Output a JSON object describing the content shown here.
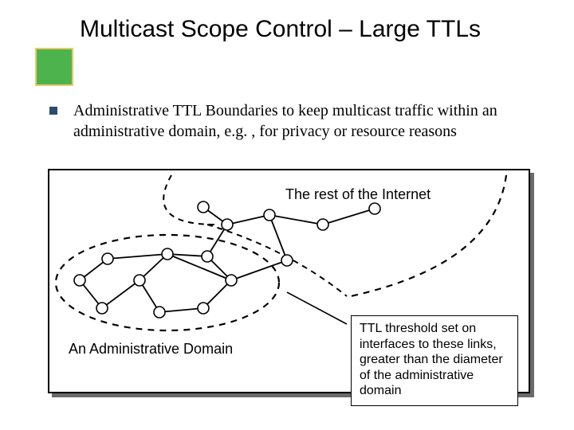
{
  "title": "Multicast Scope Control – Large TTLs",
  "bullet": "Administrative TTL Boundaries to keep multicast traffic within an administrative domain, e.g. , for privacy or resource reasons",
  "diagram": {
    "internet_label": "The rest of the Internet",
    "domain_label": "An Administrative Domain",
    "ttl_box": "TTL threshold set on interfaces to these links, greater than the diameter of the administrative domain"
  }
}
